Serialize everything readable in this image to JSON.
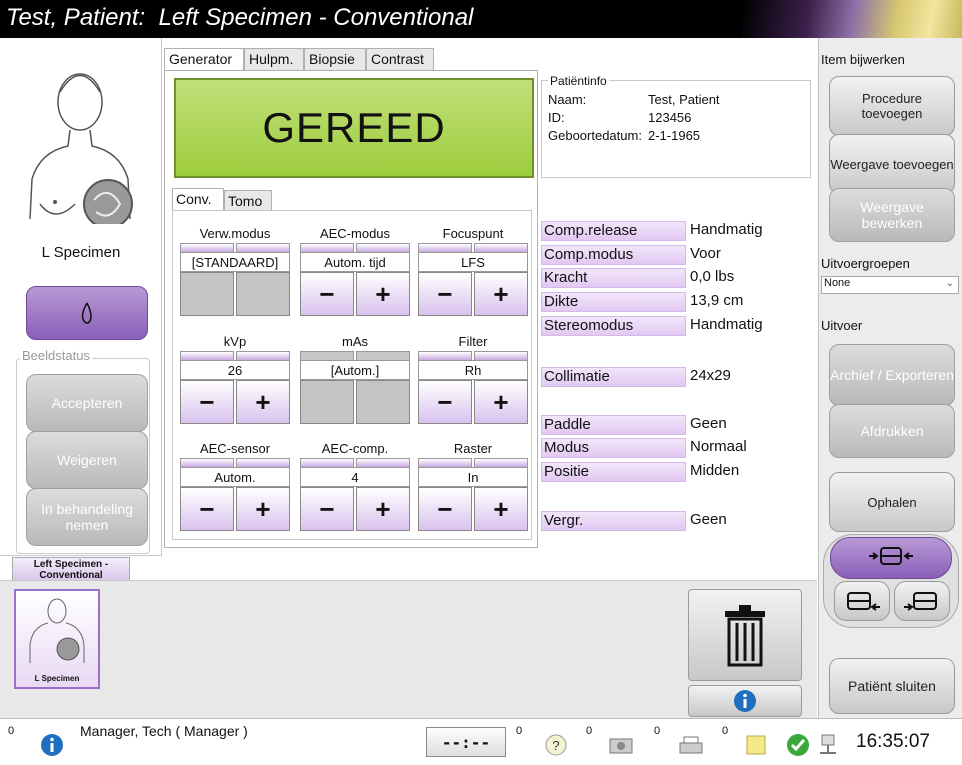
{
  "title": "Test, Patient:  Left Specimen - Conventional",
  "left": {
    "specimen_label": "L Specimen",
    "beeldstatus_label": "Beeldstatus",
    "accept_label": "Accepteren",
    "reject_label": "Weigeren",
    "pending_label": "In behandeling nemen"
  },
  "tabs": [
    "Generator",
    "Hulpm.",
    "Biopsie",
    "Contrast"
  ],
  "subtabs": [
    "Conv.",
    "Tomo"
  ],
  "status_display": "GEREED",
  "patient_info": {
    "heading": "Patiëntinfo",
    "name_label": "Naam:",
    "name": "Test, Patient",
    "id_label": "ID:",
    "id": "123456",
    "dob_label": "Geboortedatum:",
    "dob": "2-1-1965"
  },
  "controls": {
    "verw_modus": {
      "label": "Verw.modus",
      "value": "[STANDAARD]"
    },
    "aec_modus": {
      "label": "AEC-modus",
      "value": "Autom. tijd"
    },
    "focuspunt": {
      "label": "Focuspunt",
      "value": "LFS"
    },
    "kvp": {
      "label": "kVp",
      "value": "26"
    },
    "mas": {
      "label": "mAs",
      "value": "[Autom.]"
    },
    "filter": {
      "label": "Filter",
      "value": "Rh"
    },
    "aec_sensor": {
      "label": "AEC-sensor",
      "value": "Autom."
    },
    "aec_comp": {
      "label": "AEC-comp.",
      "value": "4"
    },
    "raster": {
      "label": "Raster",
      "value": "In"
    },
    "minus": "−",
    "plus": "+"
  },
  "info_rows": [
    {
      "key": "Comp.release",
      "value": "Handmatig"
    },
    {
      "key": "Comp.modus",
      "value": "Voor"
    },
    {
      "key": "Kracht",
      "value": "0,0 lbs"
    },
    {
      "key": "Dikte",
      "value": "13,9 cm"
    },
    {
      "key": "Stereomodus",
      "value": "Handmatig"
    },
    {
      "key": "Collimatie",
      "value": "24x29"
    },
    {
      "key": "Paddle",
      "value": "Geen"
    },
    {
      "key": "Modus",
      "value": "Normaal"
    },
    {
      "key": "Positie",
      "value": "Midden"
    },
    {
      "key": "Vergr.",
      "value": "Geen"
    }
  ],
  "right": {
    "item_update_label": "Item bijwerken",
    "add_procedure": "Procedure toevoegen",
    "add_view": "Weergave toevoegen",
    "edit_view": "Weergave bewerken",
    "output_groups_label": "Uitvoergroepen",
    "output_group_value": "None",
    "output_label": "Uitvoer",
    "archive_export": "Archief / Exporteren",
    "print": "Afdrukken",
    "fetch": "Ophalen",
    "close_patient": "Patiënt sluiten"
  },
  "tray": {
    "procedure_tab": "Left Specimen - Conventional",
    "thumb_label": "L Specimen"
  },
  "statusbar": {
    "count0": "0",
    "user": "Manager, Tech ( Manager )",
    "timer": "--:--",
    "count1": "0",
    "count2": "0",
    "count3": "0",
    "count4": "0",
    "time": "16:35:07"
  },
  "colors": {
    "ready_green": "#a8d44a",
    "accent_purple": "#9b6fc8",
    "title_bg": "#000000"
  }
}
